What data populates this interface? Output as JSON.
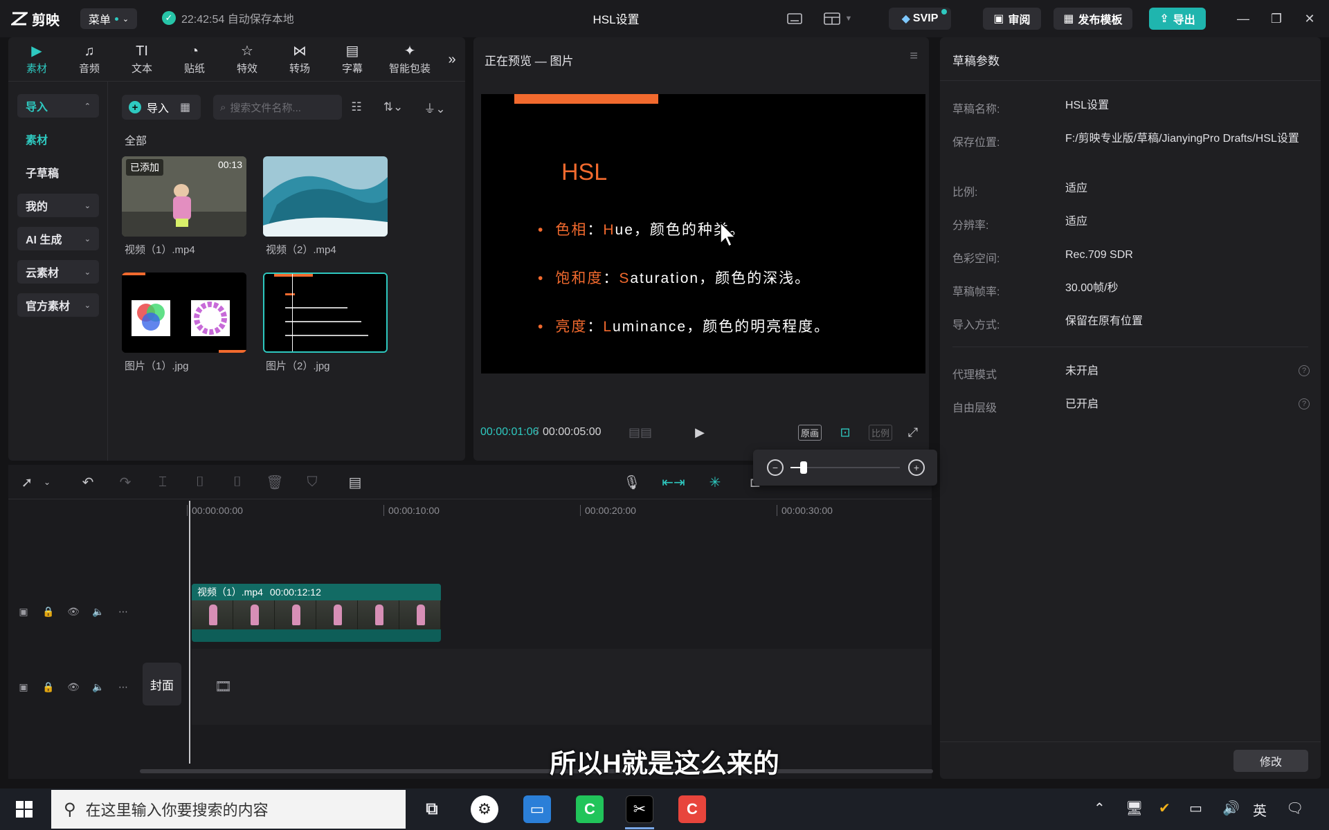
{
  "titlebar": {
    "logo_text": "剪映",
    "menu_label": "菜单",
    "save_time": "22:42:54 自动保存本地",
    "title": "HSL设置",
    "svip_label": "SVIP",
    "review_label": "审阅",
    "publish_label": "发布模板",
    "export_label": "导出"
  },
  "tools": [
    {
      "label": "素材",
      "icon": "media-icon"
    },
    {
      "label": "音频",
      "icon": "audio-icon"
    },
    {
      "label": "文本",
      "icon": "text-icon",
      "glyph": "TI"
    },
    {
      "label": "贴纸",
      "icon": "sticker-icon"
    },
    {
      "label": "特效",
      "icon": "effects-icon"
    },
    {
      "label": "转场",
      "icon": "transition-icon"
    },
    {
      "label": "字幕",
      "icon": "caption-icon"
    },
    {
      "label": "智能包装",
      "icon": "smart-pack-icon"
    }
  ],
  "sidenav": {
    "import": "导入",
    "media": "素材",
    "subdraft": "子草稿",
    "mine": "我的",
    "ai": "AI 生成",
    "cloud": "云素材",
    "official": "官方素材"
  },
  "media": {
    "import_btn": "导入",
    "search_placeholder": "搜索文件名称...",
    "section": "全部",
    "items": [
      {
        "caption": "视频（1）.mp4",
        "tag": "已添加",
        "duration": "00:13"
      },
      {
        "caption": "视频（2）.mp4"
      },
      {
        "caption": "图片（1）.jpg"
      },
      {
        "caption": "图片（2）.jpg"
      }
    ]
  },
  "preview": {
    "title": "正在预览 — 图片",
    "slide_title": "HSL",
    "bullets": [
      {
        "key": "色相",
        "sep": "：",
        "initial": "H",
        "rest": "ue，颜色的种类。"
      },
      {
        "key": "饱和度",
        "sep": "：",
        "initial": "S",
        "rest": "aturation，颜色的深浅。"
      },
      {
        "key": "亮度",
        "sep": "：",
        "initial": "L",
        "rest": "uminance，颜色的明亮程度。"
      }
    ],
    "current_time": "00:00:01:06",
    "sep": "/",
    "total_time": "00:00:05:00",
    "original_btn": "原画",
    "ratio_btn": "比例"
  },
  "draft": {
    "title": "草稿参数",
    "props": [
      {
        "k": "草稿名称:",
        "v": "HSL设置"
      },
      {
        "k": "保存位置:",
        "v": "F:/剪映专业版/草稿/JianyingPro Drafts/HSL设置"
      },
      {
        "k": "比例:",
        "v": "适应"
      },
      {
        "k": "分辨率:",
        "v": "适应"
      },
      {
        "k": "色彩空间:",
        "v": "Rec.709 SDR"
      },
      {
        "k": "草稿帧率:",
        "v": "30.00帧/秒"
      },
      {
        "k": "导入方式:",
        "v": "保留在原有位置"
      }
    ],
    "props2": [
      {
        "k": "代理模式",
        "v": "未开启"
      },
      {
        "k": "自由层级",
        "v": "已开启"
      }
    ],
    "modify_btn": "修改"
  },
  "timeline": {
    "ruler": [
      "00:00:00:00",
      "00:00:10:00",
      "00:00:20:00",
      "00:00:30:00"
    ],
    "clip_name": "视频（1）.mp4",
    "clip_duration": "00:00:12:12",
    "cover_label": "封面",
    "zoom_level": 0.12
  },
  "subtitle": "所以H就是这么来的",
  "taskbar": {
    "search_placeholder": "在这里输入你要搜索的内容",
    "ime": "英"
  },
  "colors": {
    "accent": "#2ec9c0",
    "slide_orange": "#f26a2e",
    "export_bg": "#1fb5ae"
  }
}
